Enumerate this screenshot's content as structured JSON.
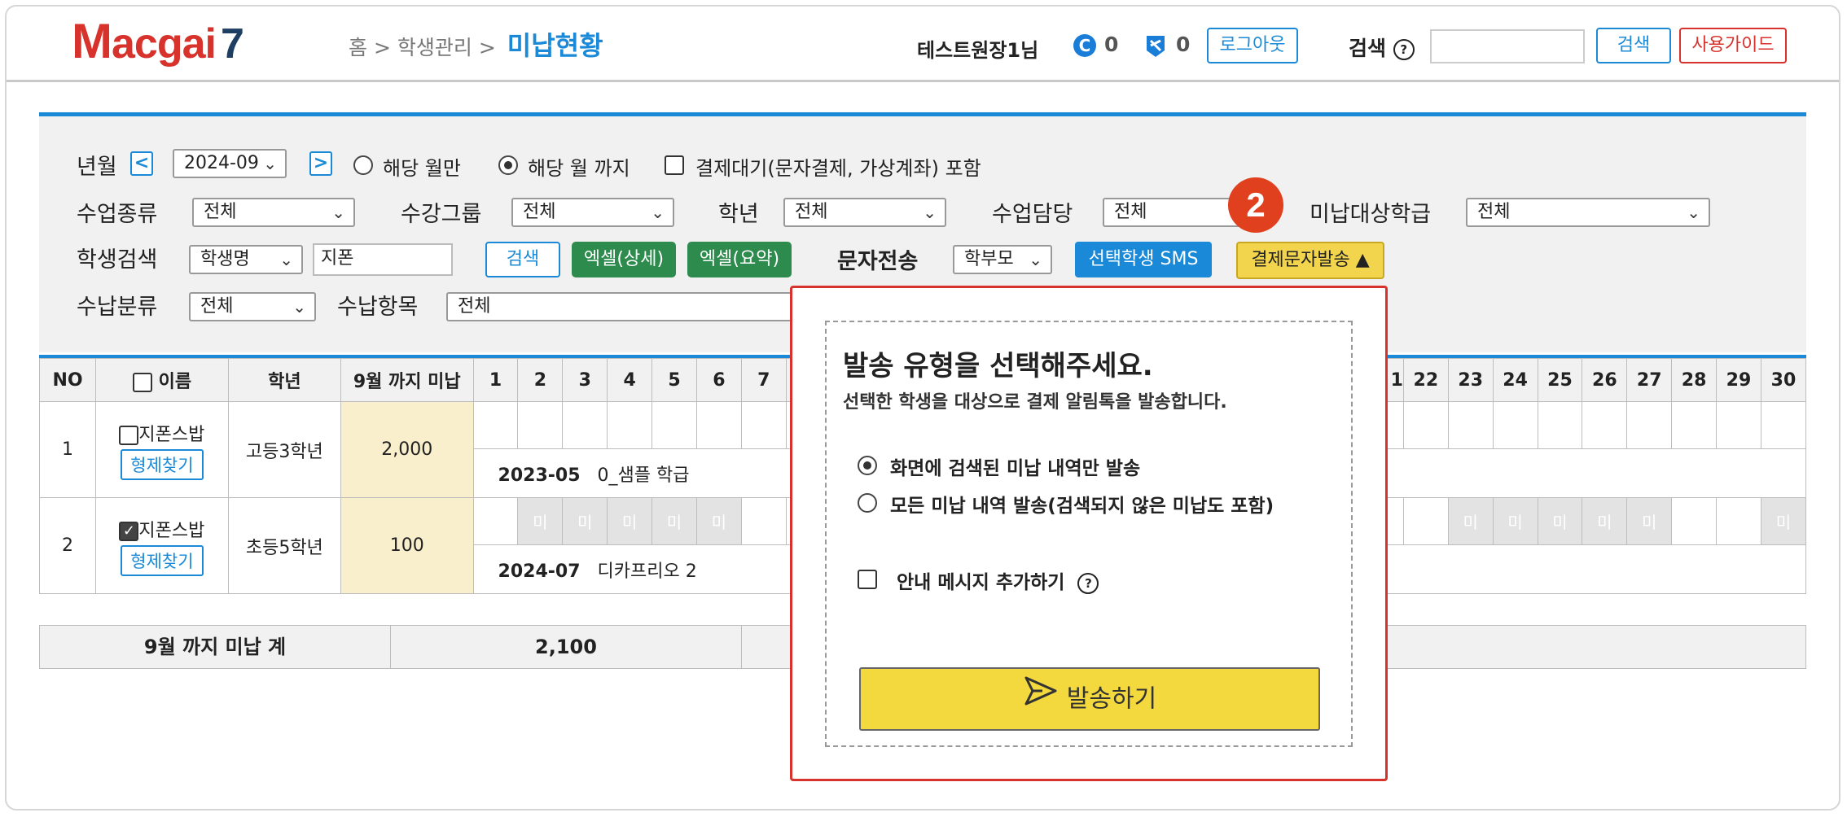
{
  "header": {
    "logo": {
      "m": "M",
      "rest": "acgai",
      "seven": "7"
    },
    "breadcrumb": {
      "home": "홈",
      "sep1": ">",
      "section": "학생관리",
      "sep2": ">",
      "current": "미납현황"
    },
    "user": "테스트원장1님",
    "coin_count": "0",
    "ticket_count": "0",
    "logout": "로그아웃",
    "search_label": "검색",
    "search_button": "검색",
    "guide_button": "사용가이드"
  },
  "filters": {
    "month_label": "년월",
    "month_value": "2024-09",
    "prev": "<",
    "next": ">",
    "only_month": "해당 월만",
    "until_month": "해당 월 까지",
    "pending_payment": "결제대기(문자결제, 가상계좌) 포함",
    "class_type_label": "수업종류",
    "class_type_value": "전체",
    "group_label": "수강그룹",
    "group_value": "전체",
    "grade_label": "학년",
    "grade_value": "전체",
    "teacher_label": "수업담당",
    "teacher_value": "전체",
    "target_fee_label": "미납대상학급",
    "target_fee_value": "전체",
    "student_search_label": "학생검색",
    "student_search_field": "학생명",
    "student_search_value": "지폰",
    "search_button": "검색",
    "excel_detail": "엑셀(상세)",
    "excel_summary": "엑셀(요약)",
    "sms_label": "문자전송",
    "sms_target": "학부모",
    "sms_selected": "선택학생 SMS",
    "payment_sms": "결제문자발송 ▲",
    "payment_category_label": "수납분류",
    "payment_category_value": "전체",
    "payment_item_label": "수납항목",
    "payment_item_value": "전체"
  },
  "table": {
    "headers": {
      "no": "NO",
      "name": "이름",
      "grade": "학년",
      "unpaid": "9월 까지 미납"
    },
    "days_left": [
      "1",
      "2",
      "3",
      "4",
      "5",
      "6",
      "7"
    ],
    "days_right": [
      "1",
      "22",
      "23",
      "24",
      "25",
      "26",
      "27",
      "28",
      "29",
      "30"
    ],
    "rows": [
      {
        "no": "1",
        "name": "지폰스밥",
        "find": "형제찾기",
        "grade": "고등3학년",
        "unpaid": "2,000",
        "month": "2023-05",
        "item": "0_샘플 학급"
      },
      {
        "no": "2",
        "name": "지폰스밥",
        "find": "형제찾기",
        "grade": "초등5학년",
        "unpaid": "100",
        "month": "2024-07",
        "item": "디카프리오 2"
      }
    ],
    "mi": "미"
  },
  "summary": {
    "label": "9월 까지 미납 계",
    "total": "2,100"
  },
  "step_badge": "2",
  "popup": {
    "title": "발송 유형을 선택해주세요.",
    "subtitle": "선택한 학생을 대상으로 결제 알림톡을 발송합니다.",
    "option1": "화면에 검색된 미납 내역만 발송",
    "option2": "모든 미납 내역 발송(검색되지 않은 미납도 포함)",
    "add_message": "안내 메시지 추가하기",
    "send": "발송하기"
  }
}
